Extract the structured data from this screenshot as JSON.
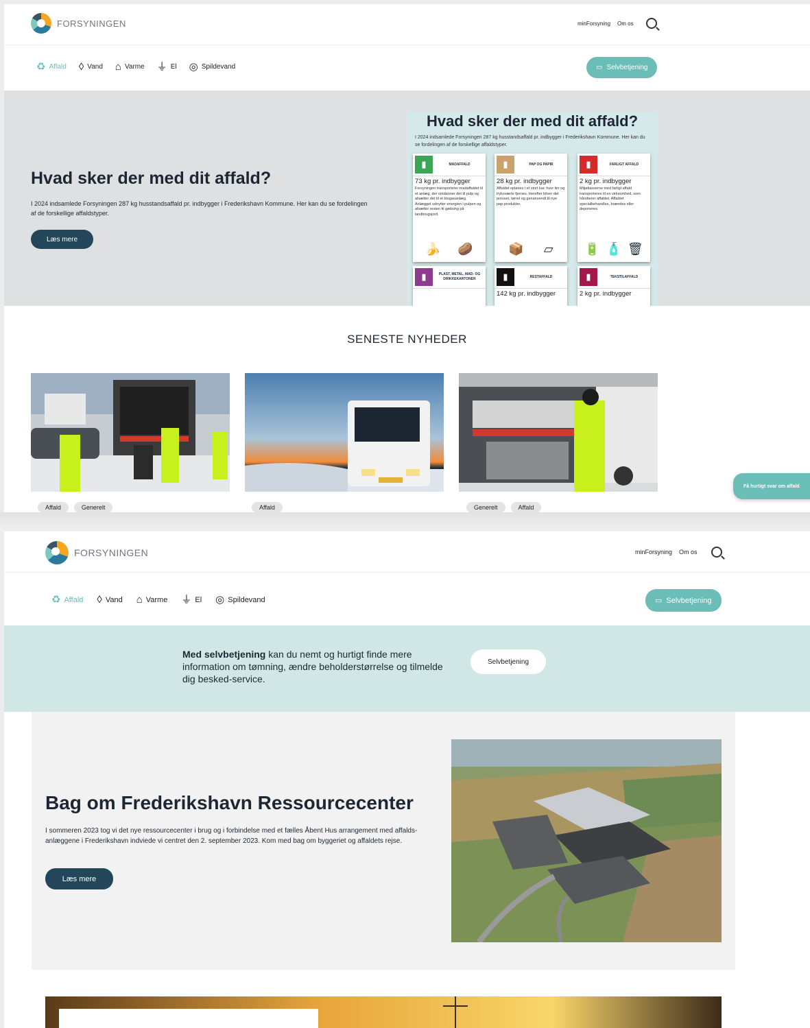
{
  "brand": {
    "name": "FORSYNINGEN"
  },
  "toplinks": {
    "min": "minForsyning",
    "about": "Om os"
  },
  "nav": {
    "items": [
      {
        "label": "Affald",
        "icon": "recycle-icon"
      },
      {
        "label": "Vand",
        "icon": "water-drop-icon"
      },
      {
        "label": "Varme",
        "icon": "heat-house-icon"
      },
      {
        "label": "El",
        "icon": "plug-icon"
      },
      {
        "label": "Spildevand",
        "icon": "wastewater-icon"
      }
    ],
    "self_service": "Selvbetjening"
  },
  "hero": {
    "title": "Hvad sker der med dit affald?",
    "text": "I 2024 indsamlede Forsyningen 287 kg husstandsaffald pr. indbygger i Frederikshavn Kommune. Her kan du se fordelingen af de forskellige affaldstyper.",
    "button": "Læs mere"
  },
  "infographic": {
    "title": "Hvad sker der med dit affald?",
    "subtitle": "I 2024 indsamlede Forsyningen 287 kg husstandsaffald pr. indbygger i Frederikshavn Kommune. Her kan du se fordelingen af de forskellige affaldstyper.",
    "cards": [
      {
        "category": "MADAFFALD",
        "kg": "73 kg pr. indbygger",
        "color": "#3aa655",
        "text": "Forsyningen transporterer madaffaldet til et anlæg, der omdanner det til pulp og afsætter det til et biogasanlæg. Anlægget udnytter energien i pulpen og afsætter resten til gødning på landbrugsjord."
      },
      {
        "category": "PAP OG PAPIR",
        "kg": "28 kg pr. indbygger",
        "color": "#c9a36b",
        "text": "Affaldet opløses i et stort kar, hvor lim og tryksværte fjernes. Herefter bliver det presset, tørret og genanvendt til nye pap-produkter."
      },
      {
        "category": "FARLIGT AFFALD",
        "kg": "2 kg pr. indbygger",
        "color": "#d52b2b",
        "text": "Miljøkasserne med farligt affald transporteres til en virksomhed, som håndterer affaldet. Affaldet specialbehandles, brændes eller deponeres."
      },
      {
        "category": "PLAST, METAL, MAD- OG DRIKKEKARTONER",
        "kg": "",
        "color": "#8e3b8f",
        "text": ""
      },
      {
        "category": "RESTAFFALD",
        "kg": "142 kg pr. indbygger",
        "color": "#111111",
        "text": ""
      },
      {
        "category": "TEKSTILAFFALD",
        "kg": "2 kg pr. indbygger",
        "color": "#a4174a",
        "text": ""
      }
    ]
  },
  "news": {
    "title": "SENESTE NYHEDER",
    "items": [
      {
        "tags": [
          "Affald",
          "Generelt"
        ]
      },
      {
        "tags": [
          "Affald"
        ]
      },
      {
        "tags": [
          "Generelt",
          "Affald"
        ]
      }
    ]
  },
  "floating": {
    "label": "Få hurtigt svar om affald"
  },
  "selfservice_band": {
    "bold": "Med selvbetjening",
    "text": " kan du nemt og hurtigt finde mere information om tømning, ændre beholderstørrelse og tilmelde dig besked-service.",
    "button": "Selvbetjening"
  },
  "ressourcecenter": {
    "title": "Bag om Frederikshavn Ressourcecenter",
    "text": "I sommeren 2023 tog vi det nye ressourcecenter i brug og i forbindelse med et fælles Åbent Hus arrangement med affalds-anlæggene i Frederikshavn indviede vi centret den 2. september 2023. Kom med bag om byggeriet og affaldets rejse.",
    "button": "Læs mere"
  },
  "colors": {
    "accent": "#6bbdb8",
    "dark": "#23465a",
    "band": "#d0e7e6"
  }
}
